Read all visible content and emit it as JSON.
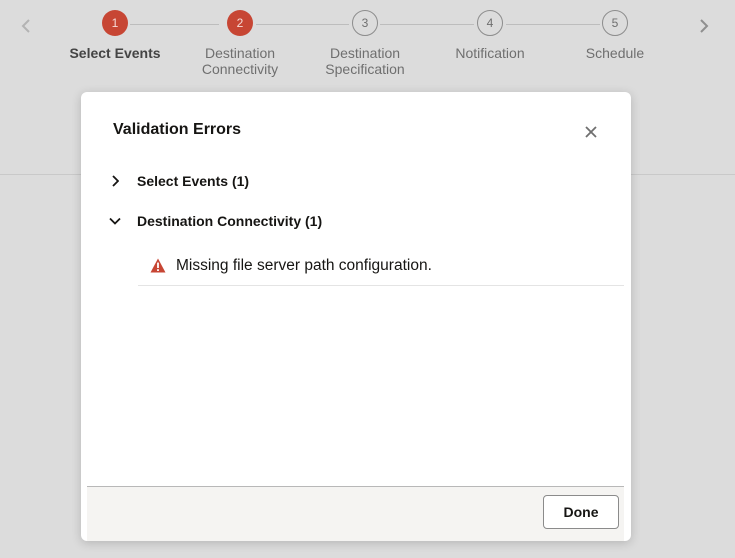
{
  "train": {
    "steps": [
      {
        "number": "1",
        "label": "Select Events",
        "state": "error-current"
      },
      {
        "number": "2",
        "label": "Destination Connectivity",
        "state": "error"
      },
      {
        "number": "3",
        "label": "Destination Specification",
        "state": "normal"
      },
      {
        "number": "4",
        "label": "Notification",
        "state": "normal"
      },
      {
        "number": "5",
        "label": "Schedule",
        "state": "normal"
      }
    ],
    "prev_icon": "chevron-left-icon",
    "next_icon": "chevron-right-icon"
  },
  "dialog": {
    "title": "Validation Errors",
    "close_icon": "close-icon",
    "groups": [
      {
        "label": "Select Events (1)",
        "expanded": false
      },
      {
        "label": "Destination Connectivity (1)",
        "expanded": true
      }
    ],
    "error_message": "Missing file server path configuration.",
    "error_icon": "warning-triangle-icon",
    "done_label": "Done"
  },
  "colors": {
    "error_red": "#c74634",
    "backdrop": "#dcdcdc",
    "footer": "#f5f4f2"
  }
}
